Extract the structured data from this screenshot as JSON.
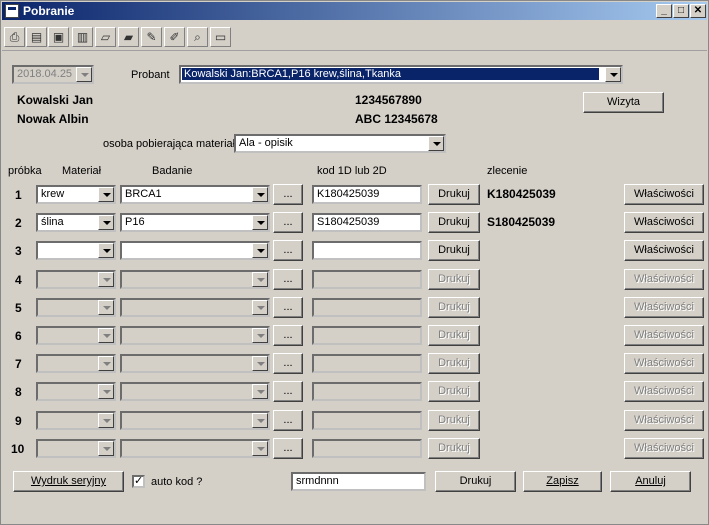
{
  "window": {
    "title": "Pobranie"
  },
  "toolbar": {
    "icons": [
      "printer-icon",
      "document-icon",
      "print-preview-icon",
      "chart-icon",
      "folder-open-icon",
      "folder-arrow-icon",
      "tools-icon",
      "tools-alt-icon",
      "magnifier-icon",
      "card-icon"
    ]
  },
  "header": {
    "date": "2018.04.25",
    "probant_label": "Probant",
    "probant_value": "Kowalski Jan:BRCA1,P16 krew,ślina,Tkanka",
    "person1_name": "Kowalski Jan",
    "person1_id": "1234567890",
    "person2_name": "Nowak Albin",
    "person2_id": "ABC 12345678",
    "visit_button": "Wizyta",
    "collector_label": "osoba pobierająca materiał:",
    "collector_value": "Ala - opisik"
  },
  "columns": {
    "sample": "próbka",
    "material": "Materiał",
    "test": "Badanie",
    "code": "kod 1D lub 2D",
    "order": "zlecenie"
  },
  "rows": [
    {
      "num": "1",
      "material": "krew",
      "test": "BRCA1",
      "code": "K180425039",
      "order": "K180425039",
      "enabled": true
    },
    {
      "num": "2",
      "material": "ślina",
      "test": "P16",
      "code": "S180425039",
      "order": "S180425039",
      "enabled": true
    },
    {
      "num": "3",
      "material": "",
      "test": "",
      "code": "",
      "order": "",
      "enabled": true
    },
    {
      "num": "4",
      "material": "",
      "test": "",
      "code": "",
      "order": "",
      "enabled": false
    },
    {
      "num": "5",
      "material": "",
      "test": "",
      "code": "",
      "order": "",
      "enabled": false
    },
    {
      "num": "6",
      "material": "",
      "test": "",
      "code": "",
      "order": "",
      "enabled": false
    },
    {
      "num": "7",
      "material": "",
      "test": "",
      "code": "",
      "order": "",
      "enabled": false
    },
    {
      "num": "8",
      "material": "",
      "test": "",
      "code": "",
      "order": "",
      "enabled": false
    },
    {
      "num": "9",
      "material": "",
      "test": "",
      "code": "",
      "order": "",
      "enabled": false
    },
    {
      "num": "10",
      "material": "",
      "test": "",
      "code": "",
      "order": "",
      "enabled": false
    }
  ],
  "row_labels": {
    "ellipsis": "...",
    "print": "Drukuj",
    "properties": "Właściwości"
  },
  "footer": {
    "serial_print": "Wydruk seryjny",
    "auto_code_checked": true,
    "auto_code_label": "auto kod ?",
    "code_field": "srmdnnn",
    "print": "Drukuj",
    "save": "Zapisz",
    "cancel": "Anuluj"
  },
  "colors": {
    "titlebar_start": "#0a246a",
    "titlebar_end": "#a6caf0",
    "face": "#d4d0c8"
  }
}
